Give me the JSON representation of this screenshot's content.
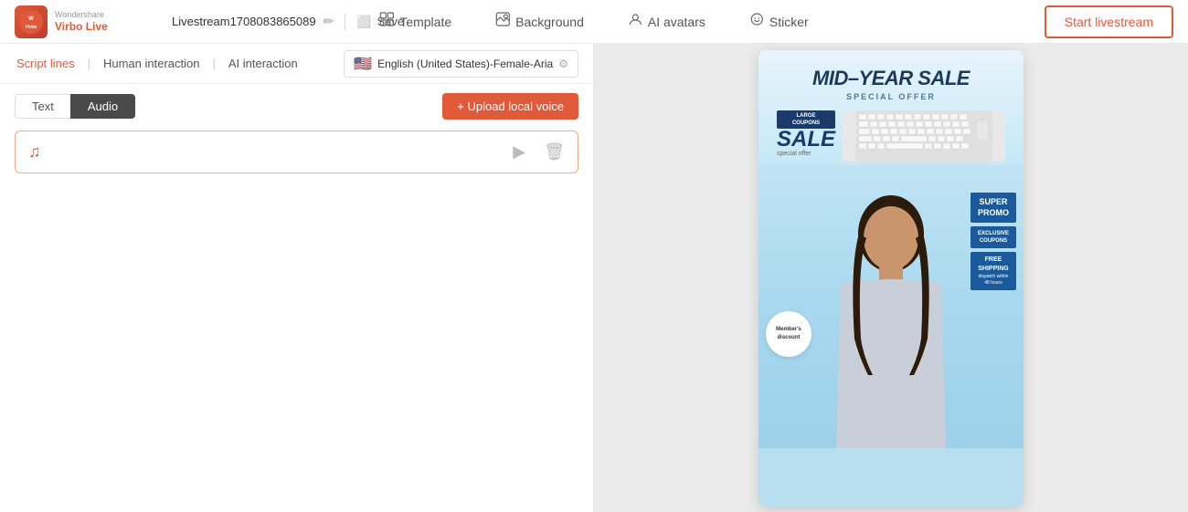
{
  "logo": {
    "brand_top": "Wondershare",
    "brand_bottom": "Virbo Live"
  },
  "header": {
    "session_name": "Livestream1708083865089",
    "save_label": "Save",
    "template_label": "Template",
    "background_label": "Background",
    "ai_avatars_label": "AI avatars",
    "sticker_label": "Sticker",
    "start_label": "Start livestream"
  },
  "tabs": {
    "script_lines": "Script lines",
    "human_interaction": "Human interaction",
    "ai_interaction": "AI interaction"
  },
  "voice": {
    "flag": "🇺🇸",
    "label": "English (United States)-Female-Aria"
  },
  "toggle": {
    "text_label": "Text",
    "audio_label": "Audio"
  },
  "upload": {
    "label": "+ Upload local voice"
  },
  "audio_item": {
    "icon": "♫",
    "play_icon": "▶",
    "delete_icon": "🗑"
  },
  "preview": {
    "title": "MID–YEAR SALE",
    "subtitle": "SPECIAL OFFER",
    "coupon_text": "LARGE\nCOUPONS",
    "sale_text": "SALE",
    "special_offer": "special offer",
    "super_promo": "SUPER\nPROMO",
    "exclusive": "EXCLUSIVE\nCOUPONS",
    "free_shipping": "FREE\nSHIPPING",
    "shipping_sub": "dispatch within\n48 hours",
    "member_discount": "Member's\ndiscount"
  }
}
